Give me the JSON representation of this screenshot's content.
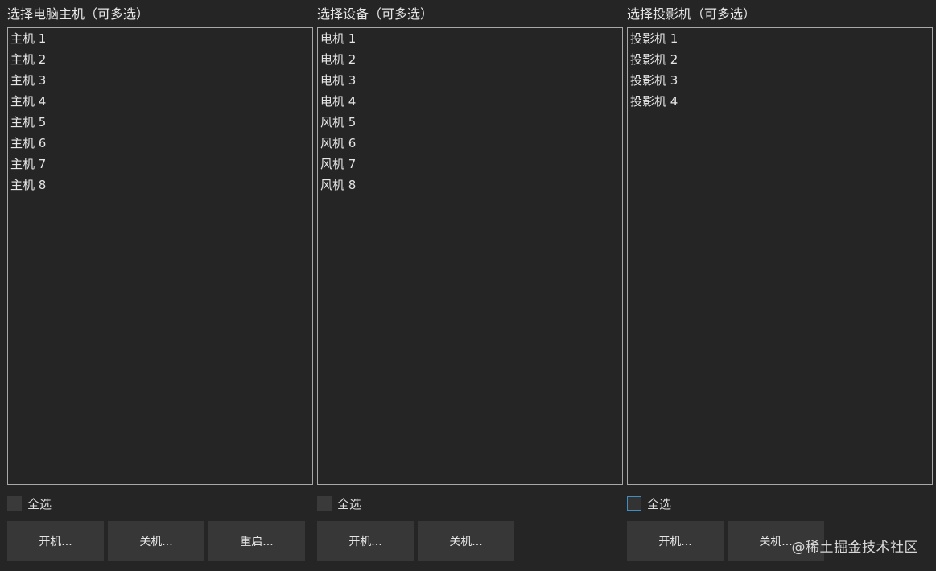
{
  "panels": [
    {
      "title": "选择电脑主机（可多选）",
      "items": [
        "主机 1",
        "主机 2",
        "主机 3",
        "主机 4",
        "主机 5",
        "主机 6",
        "主机 7",
        "主机 8"
      ],
      "select_all": "全选",
      "buttons": [
        "开机...",
        "关机...",
        "重启..."
      ]
    },
    {
      "title": "选择设备（可多选）",
      "items": [
        "电机 1",
        "电机 2",
        "电机 3",
        "电机 4",
        "风机 5",
        "风机 6",
        "风机 7",
        "风机 8"
      ],
      "select_all": "全选",
      "buttons": [
        "开机...",
        "关机..."
      ]
    },
    {
      "title": "选择投影机（可多选）",
      "items": [
        "投影机 1",
        "投影机 2",
        "投影机 3",
        "投影机 4"
      ],
      "select_all": "全选",
      "buttons": [
        "开机...",
        "关机..."
      ]
    }
  ],
  "watermark": "@稀土掘金技术社区"
}
